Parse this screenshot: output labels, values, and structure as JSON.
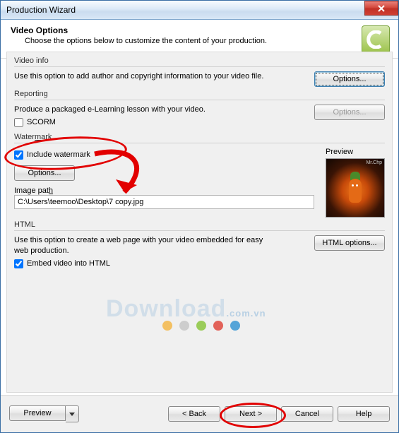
{
  "window": {
    "title": "Production Wizard"
  },
  "header": {
    "title": "Video Options",
    "subtitle": "Choose the options below to customize the content of your production."
  },
  "video_info": {
    "group": "Video info",
    "desc": "Use this option to add author and copyright information to your video file.",
    "button": "Options..."
  },
  "reporting": {
    "group": "Reporting",
    "desc": "Produce a packaged e-Learning lesson with your video.",
    "scorm_label": "SCORM",
    "scorm_checked": false,
    "button": "Options..."
  },
  "watermark": {
    "group": "Watermark",
    "include_label": "Include watermark",
    "include_checked": true,
    "options_button": "Options...",
    "image_path_label": "Image path",
    "image_path": "C:\\Users\\teemoo\\Desktop\\7 copy.jpg",
    "preview_label": "Preview",
    "preview_badge": "Mr.Chp"
  },
  "html": {
    "group": "HTML",
    "desc": "Use this option to create a web page with your video embedded for easy web production.",
    "embed_label": "Embed video into HTML",
    "embed_checked": true,
    "button": "HTML options..."
  },
  "footer": {
    "preview": "Preview",
    "back": "< Back",
    "next": "Next >",
    "cancel": "Cancel",
    "help": "Help"
  },
  "branding": {
    "text": "Download",
    "suffix": ".com.vn",
    "dot_colors": [
      "#f4b84a",
      "#c7c7c7",
      "#8cc63f",
      "#e04a3f",
      "#3a97d4"
    ]
  }
}
